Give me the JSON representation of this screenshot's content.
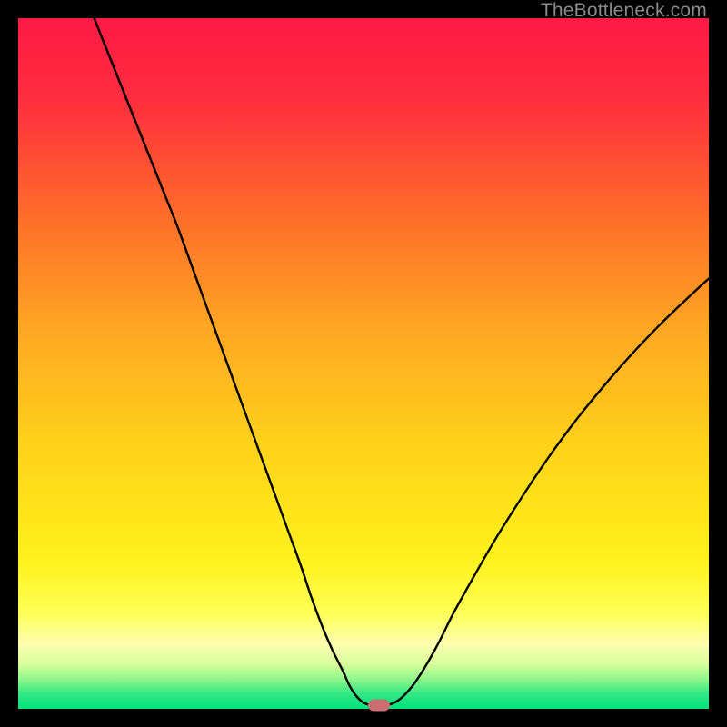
{
  "watermark": {
    "text": "TheBottleneck.com"
  },
  "chart_data": {
    "type": "line",
    "title": "",
    "xlabel": "",
    "ylabel": "",
    "xlim": [
      0,
      100
    ],
    "ylim": [
      0,
      100
    ],
    "grid": false,
    "background_gradient": {
      "stops": [
        {
          "offset": 0.0,
          "color": "#ff1a44"
        },
        {
          "offset": 0.12,
          "color": "#ff2e3e"
        },
        {
          "offset": 0.28,
          "color": "#ff6a2a"
        },
        {
          "offset": 0.45,
          "color": "#ffa722"
        },
        {
          "offset": 0.62,
          "color": "#ffd21a"
        },
        {
          "offset": 0.78,
          "color": "#fff11a"
        },
        {
          "offset": 0.86,
          "color": "#ffff55"
        },
        {
          "offset": 0.905,
          "color": "#ffffb0"
        },
        {
          "offset": 0.935,
          "color": "#d9ff9c"
        },
        {
          "offset": 0.958,
          "color": "#8cf58a"
        },
        {
          "offset": 0.978,
          "color": "#33e884"
        },
        {
          "offset": 1.0,
          "color": "#00e17a"
        }
      ]
    },
    "series": [
      {
        "name": "bottleneck-curve",
        "color": "#000000",
        "x": [
          11,
          13,
          15,
          17,
          19,
          21,
          23,
          25,
          27,
          29,
          31,
          33,
          35,
          37,
          39,
          41,
          42.5,
          44,
          45.5,
          47,
          48,
          49,
          50,
          51.5,
          53,
          55,
          57,
          59,
          61,
          63,
          66,
          69,
          72,
          75,
          78,
          81,
          84,
          87,
          90,
          93,
          96,
          99,
          100
        ],
        "y": [
          100,
          95,
          90,
          85,
          80,
          75,
          70,
          64.5,
          59,
          53.5,
          48,
          42.5,
          37,
          31.5,
          26,
          20.5,
          16,
          12,
          8.5,
          5.5,
          3.3,
          1.8,
          0.9,
          0.4,
          0.4,
          1.2,
          3.2,
          6.2,
          9.8,
          13.8,
          19.2,
          24.4,
          29.2,
          33.8,
          38.1,
          42.1,
          45.8,
          49.3,
          52.6,
          55.7,
          58.6,
          61.4,
          62.3
        ]
      }
    ],
    "marker": {
      "x": 52.2,
      "y": 0.55,
      "color": "#cc6f72"
    }
  }
}
